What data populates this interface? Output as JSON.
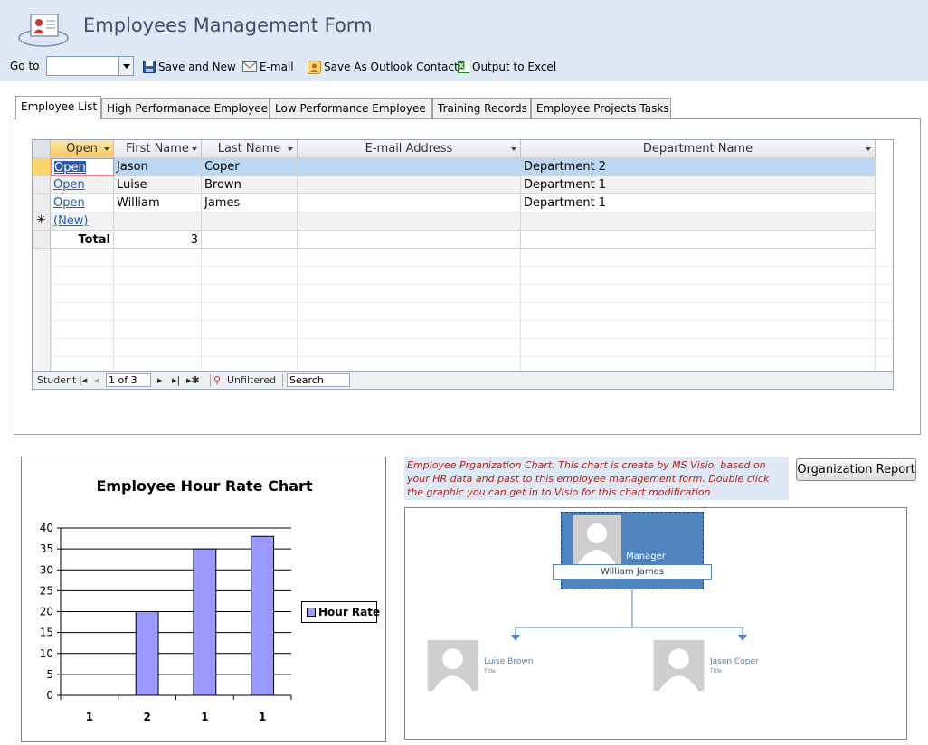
{
  "header": {
    "title": "Employees Management Form"
  },
  "toolbar": {
    "goto_label": "Go to",
    "goto_value": "",
    "save_and_new": "Save and New",
    "email": "E-mail",
    "save_outlook": "Save As Outlook Contact",
    "output_excel": "Output to Excel"
  },
  "tabs": [
    {
      "label": "Employee List",
      "active": true
    },
    {
      "label": "High Performanace Employee"
    },
    {
      "label": "Low Performance Employee"
    },
    {
      "label": "Training Records"
    },
    {
      "label": "Employee Projects Tasks"
    }
  ],
  "grid": {
    "columns": [
      "Open",
      "First Name",
      "Last Name",
      "E-mail Address",
      "Department Name"
    ],
    "rows": [
      {
        "open": "Open",
        "first": "Jason",
        "last": "Coper",
        "email": "",
        "dept": "Department 2"
      },
      {
        "open": "Open",
        "first": "Luise",
        "last": "Brown",
        "email": "",
        "dept": "Department 1"
      },
      {
        "open": "Open",
        "first": "William",
        "last": "James",
        "email": "",
        "dept": "Department 1"
      }
    ],
    "new_row": "(New)",
    "total_label": "Total",
    "total_value": "3",
    "nav": {
      "record_label": "Student",
      "position": "1 of 3",
      "filter": "Unfiltered",
      "search": "Search"
    }
  },
  "chart_data": {
    "type": "bar",
    "title": "Employee Hour Rate  Chart",
    "categories": [
      "1",
      "2",
      "1",
      "1"
    ],
    "series": [
      {
        "name": "Hour Rate",
        "values": [
          0,
          20,
          35,
          38
        ],
        "color": "#9999ff"
      }
    ],
    "ylim": [
      0,
      40
    ],
    "yticks": [
      0,
      5,
      10,
      15,
      20,
      25,
      30,
      35,
      40
    ],
    "grid": true,
    "legend": "right"
  },
  "org": {
    "note": "Employee Prganization Chart. This chart is create by MS Visio, based on your HR data and past to this employee management form. Double click the graphic you can get in to VIsio for this chart modification",
    "button": "Organization Report",
    "manager_role": "Manager",
    "manager_name": "William James",
    "sub1_name": "Luise Brown",
    "sub1_title": "Title",
    "sub2_name": "Jason Coper",
    "sub2_title": "Title"
  }
}
